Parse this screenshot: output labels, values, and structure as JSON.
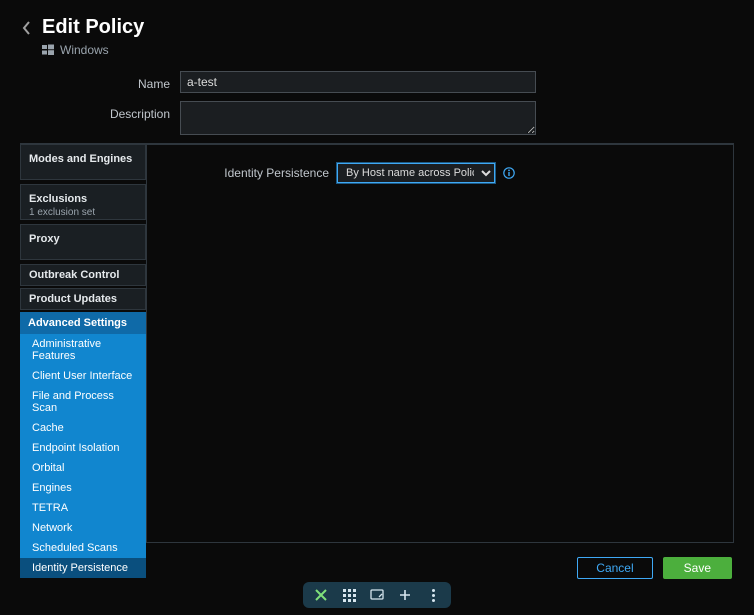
{
  "header": {
    "title": "Edit Policy",
    "platform": "Windows"
  },
  "form": {
    "name_label": "Name",
    "name_value": "a-test",
    "description_label": "Description",
    "description_value": ""
  },
  "sidebar": {
    "modes_engines": "Modes and Engines",
    "exclusions": {
      "title": "Exclusions",
      "sub": "1 exclusion set"
    },
    "proxy": "Proxy",
    "outbreak": "Outbreak Control",
    "updates": "Product Updates",
    "advanced": {
      "header": "Advanced Settings",
      "items": [
        "Administrative Features",
        "Client User Interface",
        "File and Process Scan",
        "Cache",
        "Endpoint Isolation",
        "Orbital",
        "Engines",
        "TETRA",
        "Network",
        "Scheduled Scans",
        "Identity Persistence"
      ]
    }
  },
  "content": {
    "identity_label": "Identity Persistence",
    "identity_selected": "By Host name across Policy"
  },
  "footer": {
    "cancel": "Cancel",
    "save": "Save"
  }
}
